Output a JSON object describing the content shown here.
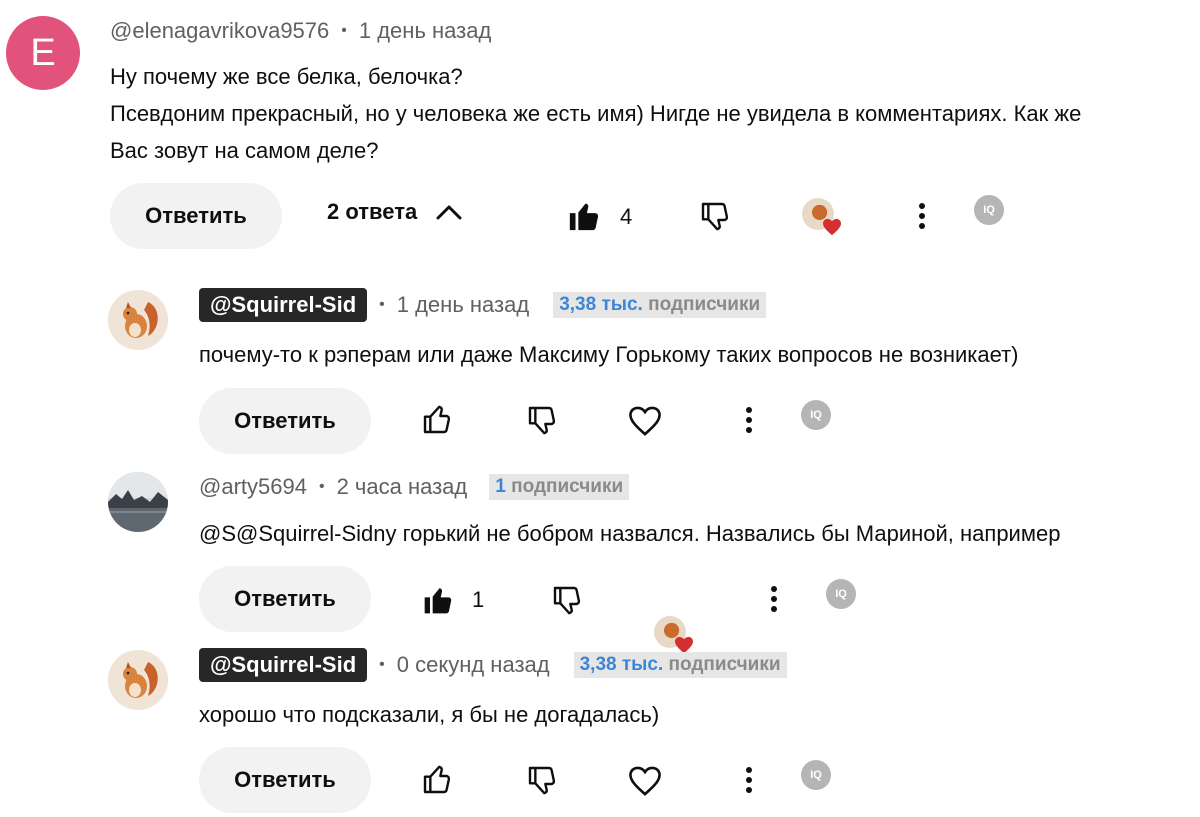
{
  "top_comment": {
    "avatar_letter": "E",
    "author": "@elenagavrikova9576",
    "time": "1 день назад",
    "lines": [
      "Ну почему же все белка, белочка?",
      "Псевдоним прекрасный, но у человека же есть имя) Нигде не увидела в комментариях. Как же",
      "Вас зовут на самом деле?"
    ],
    "reply_label": "Ответить",
    "replies_toggle": "2 ответа",
    "likes": "4"
  },
  "replies": [
    {
      "author": "@Squirrel-Sid",
      "time": "1 день назад",
      "subs_num": "3,38 тыс.",
      "subs_word": "подписчики",
      "text": "почему-то к рэперам или даже Максиму Горькому таких вопросов не возникает)",
      "reply_label": "Ответить"
    },
    {
      "author": "@arty5694",
      "time": "2 часа назад",
      "subs_num": "1",
      "subs_word": "подписчики",
      "text": "@S@Squirrel-Sidny горький не бобром назвался. Назвались бы Мариной, например",
      "reply_label": "Ответить",
      "likes": "1"
    },
    {
      "author": "@Squirrel-Sid",
      "time": "0 секунд назад",
      "subs_num": "3,38 тыс.",
      "subs_word": "подписчики",
      "text": "хорошо что подсказали, я бы не догадалась)",
      "reply_label": "Ответить"
    }
  ],
  "extension_badge": "IQ",
  "colors": {
    "avatar_bg": "#e2537c",
    "subs_number": "#3b86d6",
    "handle_pill": "#272727",
    "heart": "#d32f2f"
  }
}
